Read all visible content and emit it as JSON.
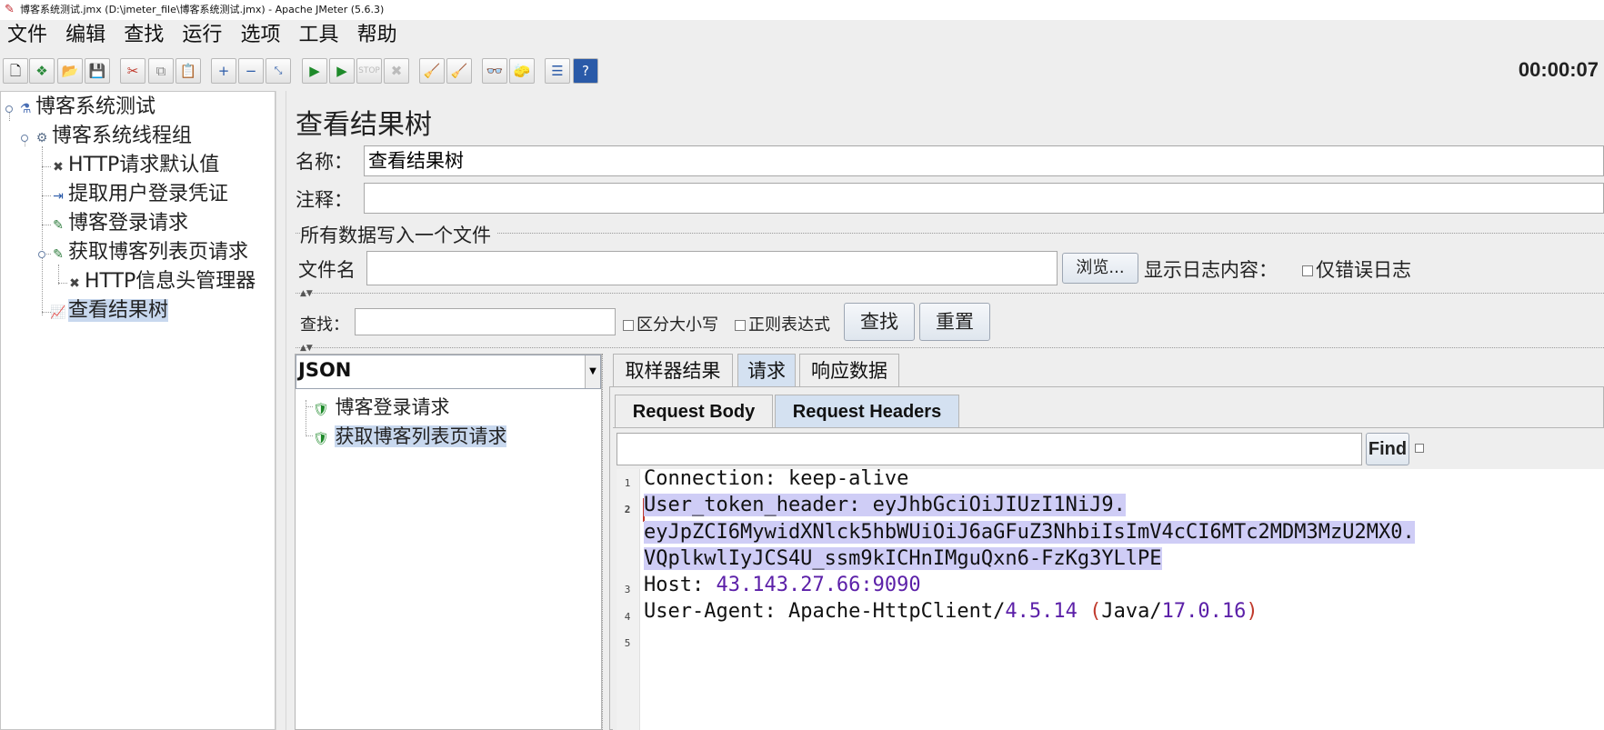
{
  "window": {
    "title": "博客系统测试.jmx (D:\\jmeter_file\\博客系统测试.jmx) - Apache JMeter (5.6.3)"
  },
  "menu": [
    "文件",
    "编辑",
    "查找",
    "运行",
    "选项",
    "工具",
    "帮助"
  ],
  "toolbar": {
    "timer": "00:00:07"
  },
  "tree": [
    {
      "label": "博客系统测试",
      "icon": "test-plan-icon"
    },
    {
      "label": "博客系统线程组",
      "icon": "gear-icon"
    },
    {
      "label": "HTTP请求默认值",
      "icon": "wrench-icon"
    },
    {
      "label": "提取用户登录凭证",
      "icon": "extractor-icon"
    },
    {
      "label": "博客登录请求",
      "icon": "pipette-icon"
    },
    {
      "label": "获取博客列表页请求",
      "icon": "pipette-icon"
    },
    {
      "label": "HTTP信息头管理器",
      "icon": "wrench-icon"
    },
    {
      "label": "查看结果树",
      "icon": "chart-icon"
    }
  ],
  "panel": {
    "title": "查看结果树",
    "name_label": "名称：",
    "name_value": "查看结果树",
    "comment_label": "注释：",
    "comment_value": "",
    "file_section": "所有数据写入一个文件",
    "filename_label": "文件名",
    "browse": "浏览...",
    "log_label": "显示日志内容：",
    "errors_only": "仅错误日志"
  },
  "search": {
    "label": "查找：",
    "case": "区分大小写",
    "regex": "正则表达式",
    "find": "查找",
    "reset": "重置"
  },
  "renderer": {
    "selected": "JSON"
  },
  "results": [
    {
      "label": "博客登录请求",
      "status": "success"
    },
    {
      "label": "获取博客列表页请求",
      "status": "success"
    }
  ],
  "tabs": [
    "取样器结果",
    "请求",
    "响应数据"
  ],
  "subtabs": [
    "Request Body",
    "Request Headers"
  ],
  "find_button": "Find",
  "headers": {
    "line_numbers": [
      "1",
      "2",
      "3",
      "4",
      "5"
    ],
    "connection_key": "Connection",
    "connection_value": "keep-alive",
    "token_key": "User_token_header",
    "token_part1": "eyJhbGciOiJIUzI1NiJ9.",
    "token_part2": "eyJpZCI6MywidXNlck5hbWUiOiJ6aGFuZ3NhbiIsImV4cCI6MTc2MDM3MzU2MX0.",
    "token_part3": "VQplkwlIyJCS4U_ssm9kICHnIMguQxn6-FzKg3YLlPE",
    "host_key": "Host",
    "host_value": "43.143.27.66:9090",
    "ua_key": "User-Agent",
    "ua_name": "Apache-HttpClient/",
    "ua_version": "4.5.14",
    "ua_java": "Java/",
    "ua_java_version": "17.0.16"
  }
}
